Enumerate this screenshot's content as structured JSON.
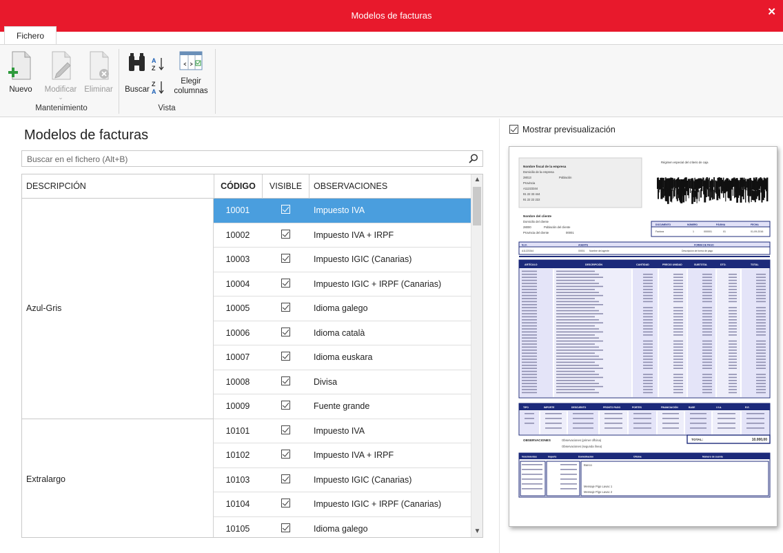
{
  "window": {
    "title": "Modelos de facturas",
    "close_glyph": "✕"
  },
  "tabs": {
    "fichero": "Fichero"
  },
  "ribbon": {
    "nuevo": "Nuevo",
    "modificar": "Modificar",
    "eliminar": "Eliminar",
    "buscar": "Buscar",
    "elegir": "Elegir",
    "columnas": "columnas",
    "group_mantenimiento": "Mantenimiento",
    "group_vista": "Vista"
  },
  "main": {
    "title": "Modelos de facturas",
    "search_placeholder": "Buscar en el fichero (Alt+B)"
  },
  "grid": {
    "headers": {
      "descripcion": "DESCRIPCIÓN",
      "codigo": "CÓDIGO",
      "visible": "VISIBLE",
      "observaciones": "OBSERVACIONES"
    },
    "groups": [
      {
        "name": "Azul-Gris",
        "rows": [
          {
            "codigo": "10001",
            "obs": "Impuesto IVA",
            "selected": true
          },
          {
            "codigo": "10002",
            "obs": "Impuesto IVA + IRPF"
          },
          {
            "codigo": "10003",
            "obs": "Impuesto IGIC (Canarias)"
          },
          {
            "codigo": "10004",
            "obs": "Impuesto IGIC + IRPF (Canarias)"
          },
          {
            "codigo": "10005",
            "obs": "Idioma galego"
          },
          {
            "codigo": "10006",
            "obs": "Idioma català"
          },
          {
            "codigo": "10007",
            "obs": "Idioma euskara"
          },
          {
            "codigo": "10008",
            "obs": "Divisa"
          },
          {
            "codigo": "10009",
            "obs": "Fuente grande"
          }
        ]
      },
      {
        "name": "Extralargo",
        "rows": [
          {
            "codigo": "10101",
            "obs": "Impuesto IVA"
          },
          {
            "codigo": "10102",
            "obs": "Impuesto IVA + IRPF"
          },
          {
            "codigo": "10103",
            "obs": "Impuesto IGIC (Canarias)"
          },
          {
            "codigo": "10104",
            "obs": "Impuesto IGIC + IRPF (Canarias)"
          },
          {
            "codigo": "10105",
            "obs": "Idioma galego"
          }
        ]
      }
    ]
  },
  "preview": {
    "toggle_label": "Mostrar previsualización",
    "empresa": "Nombre fiscal de la empresa",
    "domicilio": "Domicilio de la empresa",
    "cp": "28013",
    "poblacion": "Población",
    "provincia": "Provincia",
    "nif": "A11223344",
    "tel": "91 22 33 444",
    "fax": "91 22 22 222",
    "regimen": "Régimen especial del criterio de caja",
    "cliente": "Nombre del cliente",
    "cli_domicilio": "Domicilio del cliente",
    "cli_cp": "28000",
    "cli_poblacion": "Población del cliente",
    "cli_provincia": "Provincia del cliente",
    "cli_codigo": "00001",
    "doc_headers": [
      "DOCUMENTO",
      "NÚMERO",
      "PÁGINA",
      "FECHA"
    ],
    "doc_values": [
      "Factura",
      "1",
      "000001",
      "01",
      "01-09-2016"
    ],
    "nif_headers": [
      "N.I.F.",
      "AGENTE",
      "FORMA DE PAGO"
    ],
    "nif_values": [
      "A11223344",
      "00001",
      "Nombre del agente",
      "Descripción de forma de pago"
    ],
    "line_headers": [
      "ARTÍCULO",
      "DESCRIPCIÓN",
      "CANTIDAD",
      "PRECIO UNIDAD",
      "SUBTOTAL",
      "DTO.",
      "TOTAL"
    ],
    "tax_headers": [
      "TIPO",
      "IMPORTE",
      "DESCUENTO",
      "PRONTO PAGO",
      "PORTES",
      "FINANCIACIÓN",
      "BASE",
      "I.V.A.",
      "R.E."
    ],
    "observaciones_label": "OBSERVACIONES",
    "obs_lines": [
      "Observaciones (primer offcina)",
      "Observaciones (segunda línea)"
    ],
    "total_label": "TOTAL:",
    "total_value": "10.000,00",
    "venc_headers": [
      "Vencimientos",
      "Importe",
      "Domiciliación",
      "Oficina",
      "Número de cuenta"
    ],
    "banco": "Banco",
    "msg1": "Mensaje Pigo Lavac 1",
    "msg2": "Mensaje Pigo Lavac 2"
  },
  "colors": {
    "accent": "#e8192c",
    "selection": "#4a9ede",
    "doc_navy": "#1c2a7a",
    "doc_band": "#e1e1f7"
  }
}
